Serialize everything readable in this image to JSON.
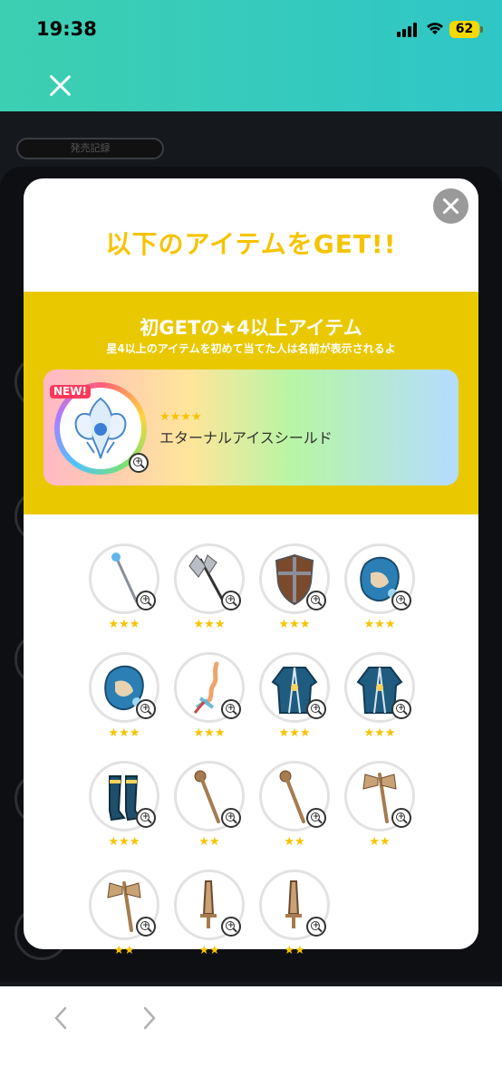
{
  "status_bar": {
    "time": "19:38",
    "battery": "62"
  },
  "background": {
    "pill_label": "発売記録"
  },
  "modal": {
    "title": "以下のアイテムをGET!!",
    "band_title": "初GETの★4以上アイテム",
    "band_subtitle": "星4以上のアイテムを初めて当てた人は名前が表示されるよ",
    "featured": {
      "badge": "NEW!",
      "stars": "★★★★",
      "name": "エターナルアイスシールド"
    },
    "items": [
      {
        "icon": "staff-icon",
        "stars": "★★★"
      },
      {
        "icon": "battle-axe-icon",
        "stars": "★★★"
      },
      {
        "icon": "shield-icon",
        "stars": "★★★"
      },
      {
        "icon": "dragon-armor-icon",
        "stars": "★★★"
      },
      {
        "icon": "dragon-armor-icon",
        "stars": "★★★"
      },
      {
        "icon": "coral-sword-icon",
        "stars": "★★★"
      },
      {
        "icon": "robe-icon",
        "stars": "★★★"
      },
      {
        "icon": "robe-icon",
        "stars": "★★★"
      },
      {
        "icon": "boots-icon",
        "stars": "★★★"
      },
      {
        "icon": "wooden-club-icon",
        "stars": "★★"
      },
      {
        "icon": "wooden-club-icon",
        "stars": "★★"
      },
      {
        "icon": "wooden-axe-icon",
        "stars": "★★"
      },
      {
        "icon": "wooden-axe-icon",
        "stars": "★★"
      },
      {
        "icon": "wooden-sword-icon",
        "stars": "★★"
      },
      {
        "icon": "wooden-sword-icon",
        "stars": "★★"
      }
    ]
  },
  "colors": {
    "accent_yellow": "#eac800",
    "title_yellow": "#f5c400",
    "header_teal": "#3dcfb1",
    "star": "#f7c300"
  }
}
